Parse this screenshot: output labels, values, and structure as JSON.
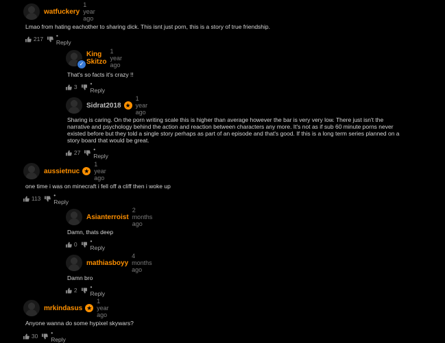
{
  "comments": [
    {
      "user": "watfuckery",
      "time": "1 year ago",
      "text": "Lmao from hating eachother to sharing dick. This isnt just porn, this is a story of true friendship.",
      "likes": "217",
      "reply": "• Reply"
    },
    {
      "user": "King Skitzo",
      "time": "1 year ago",
      "text": "That's so facts it's crazy !!",
      "likes": "3",
      "reply": "• Reply"
    },
    {
      "user": "Sidrat2018",
      "time": "1 year ago",
      "text": "Sharing is caring. On the porn writing scale this is higher than average however the bar is very very low. There just isn't the narrative and psychology behind the action and reaction between characters any more. It's not as if sub 60 minute porns never existed before but they told a single story perhaps as part of an episode and that's good. If this is a long term series planned on a story board that would be great.",
      "likes": "27",
      "reply": "• Reply"
    },
    {
      "user": "aussietnuc",
      "time": "1 year ago",
      "text": "one time i was on minecraft i fell off a cliff then i woke up",
      "likes": "113",
      "reply": "• Reply"
    },
    {
      "user": "Asianterroist",
      "time": "2 months ago",
      "text": "Damn, thats deep",
      "likes": "0",
      "reply": "• Reply"
    },
    {
      "user": "mathiasboyy",
      "time": "4 months ago",
      "text": "Damn bro",
      "likes": "2",
      "reply": "• Reply"
    },
    {
      "user": "mrkindasus",
      "time": "1 year ago",
      "text": "Anyone wanna do some hypixel skywars?",
      "likes": "30",
      "reply": "• Reply"
    }
  ],
  "colors": {
    "accent": "#ff9000",
    "verified": "#3a7bd5",
    "background": "#000000"
  },
  "icons": {
    "thumb_up": "thumbs-up-icon",
    "thumb_down": "thumbs-down-icon",
    "star": "star-badge-icon",
    "verified": "verified-check-icon"
  }
}
